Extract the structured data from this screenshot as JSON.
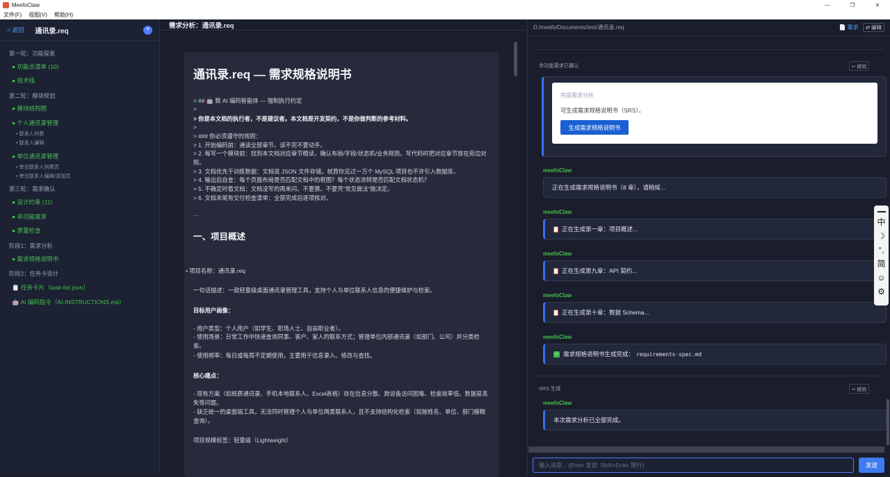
{
  "window": {
    "title": "MeefoClaw",
    "minimize": "—",
    "maximize": "❐",
    "close": "✕"
  },
  "menu": [
    "文件(F)",
    "视图(V)",
    "帮助(H)"
  ],
  "sidebar": {
    "back": "< 返回",
    "title": "通讯录.req",
    "add": "+",
    "entries": [
      {
        "kind": "section",
        "text": "第一轮：功能探索"
      },
      {
        "kind": "item",
        "text": "● 功能点清单 (10)"
      },
      {
        "kind": "item",
        "text": "● 技术栈"
      },
      {
        "kind": "section",
        "text": "第二轮：模块规划"
      },
      {
        "kind": "item",
        "text": "● 模块结构图"
      },
      {
        "kind": "item",
        "text": "● 个人通讯录管理"
      },
      {
        "kind": "sub",
        "text": "• 联系人列表"
      },
      {
        "kind": "sub",
        "text": "• 联系人编辑"
      },
      {
        "kind": "item",
        "text": "● 单位通讯录管理"
      },
      {
        "kind": "sub",
        "text": "• 单位联系人列表页"
      },
      {
        "kind": "sub",
        "text": "• 单位联系人编辑/添加页"
      },
      {
        "kind": "section",
        "text": "第三轮：需求确认"
      },
      {
        "kind": "item",
        "text": "● 设计约束 (11)"
      },
      {
        "kind": "item",
        "text": "● 非功能需求"
      },
      {
        "kind": "item",
        "text": "● 质量检查"
      },
      {
        "kind": "section",
        "text": "阶段1：需求分析"
      },
      {
        "kind": "item",
        "text": "● 需求规格说明书"
      },
      {
        "kind": "section",
        "text": "阶段2：任务卡设计"
      },
      {
        "kind": "special",
        "text": "📋 任务卡片（task-list.json）"
      },
      {
        "kind": "special",
        "text": "🤖 AI 编码指令（AI-INSTRUCTIONS.md）"
      }
    ]
  },
  "middle": {
    "header": "需求分析：通讯录.req",
    "doc_title": "通讯录.req — 需求规格说明书",
    "lines": [
      "> ## 🤖 致 AI 编码智能体 — 强制执行约定",
      ">",
      "> 你是本文档的执行者，不是建议者。本文档是开发契约，不是你做判断的参考材料。",
      ">",
      "> ### 你必须遵守的规则：",
      "> 1. 开始编码前：通读全部章节。读不完不要动手。",
      "> 2. 每写一个模块前：找到本文档对应章节精读，确认布局/字段/状态机/业务规则。写代码时把对应章节放在旁边对照。",
      "> 3. 文档优先于训练数据：文档说 JSON 文件存储，就算你见过一万个 MySQL 项目也不许引入数据库。",
      "> 4. 输出后自查：每个页面布局是否匹配文档中的框图？每个状态流转是否匹配文档状态机？",
      "> 5. 不确定时看文档：文档没写的再来问。不要猜。不要凭“常见做法”做决定。",
      "> 6. 文档末尾有交付检查清单：全部完成后逐项核对。",
      "---"
    ],
    "section1": "一、项目概述",
    "body": [
      "• 项目名称：通讯录.req",
      "一句话描述：一款轻量级桌面通讯录管理工具，支持个人与单位联系人信息的便捷维护与检索。",
      "目标用户画像：",
      "- 用户类型：个人用户（如学生、职场人士、自由职业者）。",
      "- 使用场景：日常工作中快速查询同事、客户、家人的联系方式；管理单位内部通讯录（如部门、公司）并分类检索。",
      "- 使用频率：每日或每周不定期使用，主要用于信息录入、修改与查找。",
      "核心痛点：",
      "- 现有方案（如纸质通讯录、手机本地联系人、Excel表格）存在信息分散、跨设备访问困难、检索效率低、数据易丢失等问题。",
      "- 缺乏统一的桌面端工具，无法同时管理个人与单位两类联系人，且不支持结构化检索（如按姓名、单位、部门模糊查询）。",
      "项目规模标签：轻量级（Lightweight）"
    ]
  },
  "right": {
    "path": "D:/meefo/Documents/test/通讯录.req",
    "tab_req": "📄 需求",
    "tab_edit": "⇄ 编辑",
    "divider1": "非功能需求已确认",
    "undo": "↩ 撤销",
    "card_title": "完成需求分析",
    "card_desc": "可生成需求规格说明书（SRS）。",
    "card_button": "生成需求规格说明书",
    "sender": "meefoClaw",
    "messages": [
      "正在生成需求规格说明书（8 章），请稍候...",
      "正在生成第一章：项目概述...",
      "正在生成第九章：API 契约...",
      "正在生成第十章：数据 Schema...",
      "需求规格说明书生成完成：",
      "本次需求分析已全部完成。"
    ],
    "file_code": "requirements-spec.md",
    "divider2": "SRS 生成",
    "input_placeholder": "输入消息... (Enter 发送, Shift+Enter 换行)",
    "send": "发送"
  },
  "ime": [
    "中",
    "☽",
    "°,",
    "简",
    "☺",
    "⚙"
  ]
}
